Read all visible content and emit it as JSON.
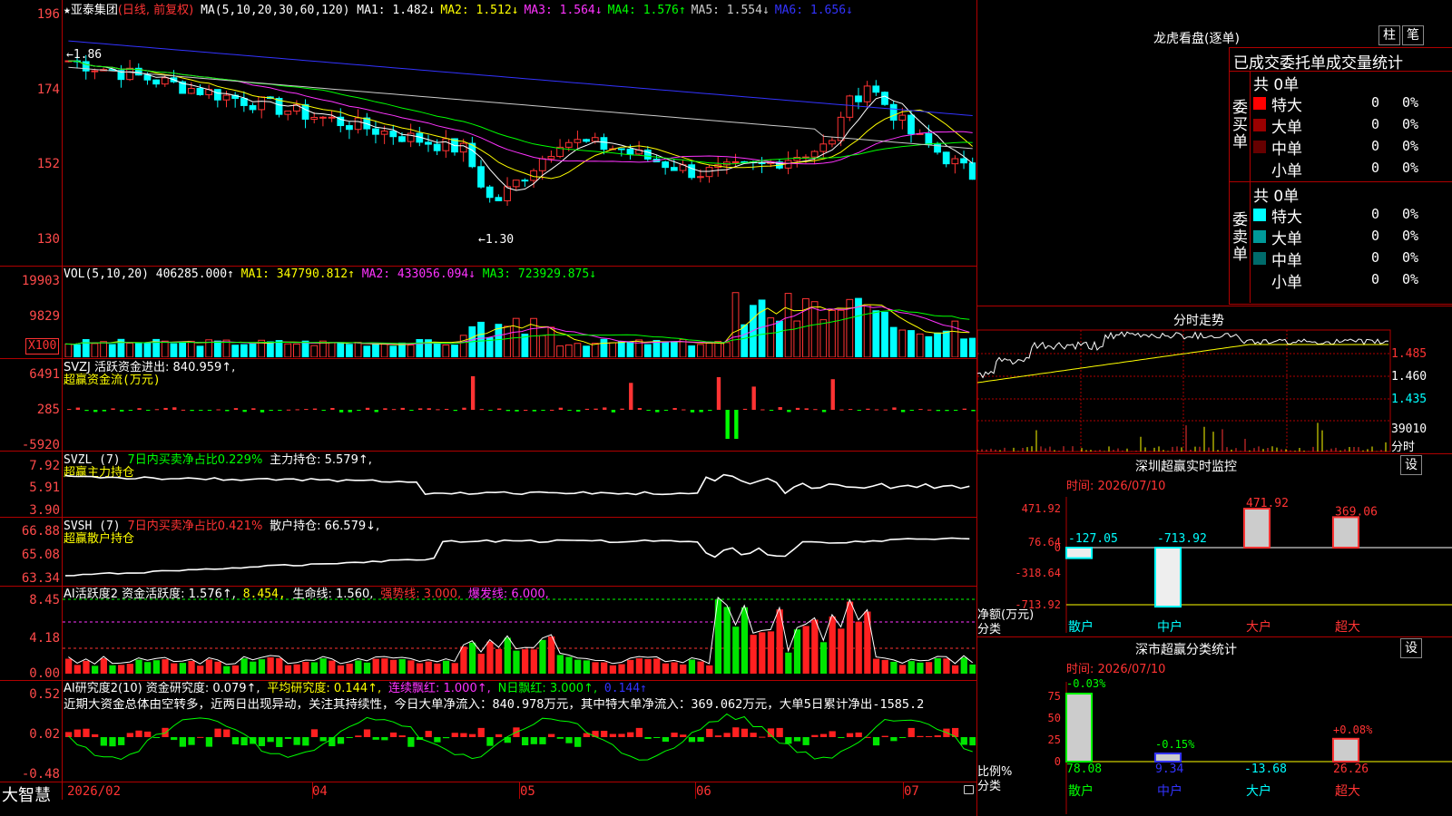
{
  "kline": {
    "star": "★",
    "stock_name": "亚泰集团",
    "mode": "(日线, 前复权)",
    "ma_def": "MA(5,10,20,30,60,120)",
    "ma_values": [
      {
        "label": "MA1:",
        "value": "1.482↓",
        "color": "#ffffff"
      },
      {
        "label": "MA2:",
        "value": "1.512↓",
        "color": "#ffff00"
      },
      {
        "label": "MA3:",
        "value": "1.564↓",
        "color": "#ff33ff"
      },
      {
        "label": "MA4:",
        "value": "1.576↑",
        "color": "#00ff00"
      },
      {
        "label": "MA5:",
        "value": "1.554↓",
        "color": "#cccccc"
      },
      {
        "label": "MA6:",
        "value": "1.656↓",
        "color": "#3333ff"
      }
    ],
    "yticks": [
      "196",
      "174",
      "152",
      "130"
    ],
    "high_mark": "1.86",
    "low_mark": "←1.30",
    "ma_colors": {
      "ma1": "#ffffff",
      "ma2": "#ffff00",
      "ma3": "#ff33ff",
      "ma4": "#00ff00",
      "ma5": "#cccccc",
      "ma6": "#3333ff"
    },
    "up_color": "#ff3333",
    "down_color": "#00ffff"
  },
  "vol": {
    "title": "VOL(5,10,20)",
    "value": "406285.000↑",
    "ma1": "MA1: 347790.812↑",
    "ma2": "MA2: 433056.094↓",
    "ma3": "MA3: 723929.875↓",
    "yticks": [
      "19903",
      "9829"
    ],
    "unit": "X100"
  },
  "svzj": {
    "title": "SVZJ  活跃资金进出: 840.959↑,",
    "subtitle": "超赢资金流(万元)",
    "yticks": [
      "6491",
      "285",
      "-5920"
    ]
  },
  "svzl": {
    "title_a": "SVZL (7)",
    "title_b": "7日内买卖净占比0.229%",
    "title_c": "主力持仓: 5.579↑,",
    "subtitle": "超赢主力持仓",
    "yticks": [
      "7.92",
      "5.91",
      "3.90"
    ]
  },
  "svsh": {
    "title_a": "SVSH (7)",
    "title_b": "7日内买卖净占比0.421%",
    "title_c": "散户持仓: 66.579↓,",
    "subtitle": "超赢散户持仓",
    "yticks": [
      "66.88",
      "65.08",
      "63.34"
    ]
  },
  "ai_active": {
    "t1": "AI活跃度2 资金活跃度: 1.576↑,",
    "t2": "8.454,",
    "t3": "生命线: 1.560,",
    "t4": "强势线: 3.000,",
    "t5": "爆发线: 6.000,",
    "yticks": [
      "8.45",
      "4.18",
      "0.00"
    ]
  },
  "ai_research": {
    "t1": "AI研究度2(10) 资金研究度: 0.079↑,",
    "t2": "平均研究度: 0.144↑,",
    "t3": "连续飘红: 1.000↑,",
    "t4": "N日飘红: 3.000↑,",
    "t5": "0.144↑",
    "comment": "近期大资金总体由空转多，近两日出现异动，关注其持续性，今日大单净流入：840.978万元，其中特大单净流入：369.062万元，大单5日累计净出-1585.2",
    "yticks": [
      "0.52",
      "0.02",
      "-0.48"
    ]
  },
  "bottom_axis": {
    "brand": "大智慧",
    "dates": [
      "2026/02",
      "04",
      "05",
      "06",
      "07"
    ]
  },
  "longhu": {
    "title": "龙虎看盘(逐单)",
    "btn_col": "柱",
    "btn_pen": "笔",
    "header": "已成交委托单成交量统计",
    "buy_label": "委买单",
    "sell_label": "委卖单",
    "buy_total": "共 0单",
    "sell_total": "共 0单",
    "buy_rows": [
      {
        "name": "特大",
        "count": "0",
        "pct": "0%",
        "color": "#ff0000"
      },
      {
        "name": "大单",
        "count": "0",
        "pct": "0%",
        "color": "#990000"
      },
      {
        "name": "中单",
        "count": "0",
        "pct": "0%",
        "color": "#660000"
      },
      {
        "name": "小单",
        "count": "0",
        "pct": "0%",
        "color": "#000000"
      }
    ],
    "sell_rows": [
      {
        "name": "特大",
        "count": "0",
        "pct": "0%",
        "color": "#00ffff"
      },
      {
        "name": "大单",
        "count": "0",
        "pct": "0%",
        "color": "#009999"
      },
      {
        "name": "中单",
        "count": "0",
        "pct": "0%",
        "color": "#006b6b"
      },
      {
        "name": "小单",
        "count": "0",
        "pct": "0%",
        "color": "#000000"
      }
    ]
  },
  "intraday": {
    "title": "分时走势",
    "yticks": [
      "1.485",
      "1.460",
      "1.435"
    ],
    "vol_label": "39010",
    "vol_unit": "分时"
  },
  "monitor": {
    "title": "深圳超赢实时监控",
    "settings": "设",
    "time": "时间: 2026/07/10",
    "yticks": [
      "471.92",
      "76.64",
      "0",
      "-318.64",
      "-713.92"
    ],
    "ylabel": "净额(万元)",
    "xlabel": "分类",
    "bars": [
      {
        "cat": "散户",
        "value": "-127.05"
      },
      {
        "cat": "中户",
        "value": "-713.92"
      },
      {
        "cat": "大户",
        "value": "471.92"
      },
      {
        "cat": "超大",
        "value": "369.06"
      }
    ]
  },
  "classify": {
    "title": "深市超赢分类统计",
    "settings": "设",
    "time": "时间: 2026/07/10",
    "yticks": [
      "75",
      "50",
      "25",
      "0"
    ],
    "ylabel": "比例%",
    "xlabel": "分类",
    "bars": [
      {
        "cat": "散户",
        "value": "78.08",
        "change": "-0.03%"
      },
      {
        "cat": "中户",
        "value": "9.34",
        "change": "-0.15%"
      },
      {
        "cat": "大户",
        "value": "-13.68",
        "change": ""
      },
      {
        "cat": "超大",
        "value": "26.26",
        "change": "+0.08%"
      }
    ]
  }
}
